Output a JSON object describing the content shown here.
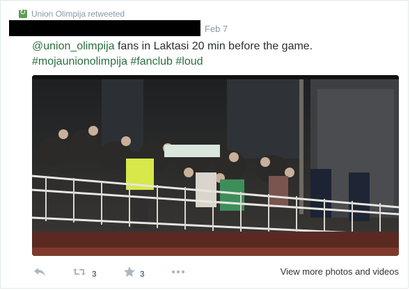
{
  "retweet": {
    "label": "Union Olimpija retweeted"
  },
  "tweet": {
    "timestamp": "Feb 7",
    "mention": "@union_olimpija",
    "text": " fans in Laktasi 20 min before the game.",
    "hashtags": [
      "#mojaunionolimpija",
      "#fanclub",
      "#loud"
    ]
  },
  "actions": {
    "retweet_count": "3",
    "favorite_count": "3",
    "view_more_label": "View more photos and videos"
  },
  "colors": {
    "link": "#2a6e3e",
    "retweet_badge": "#5c9e50",
    "muted": "#8899a6"
  }
}
